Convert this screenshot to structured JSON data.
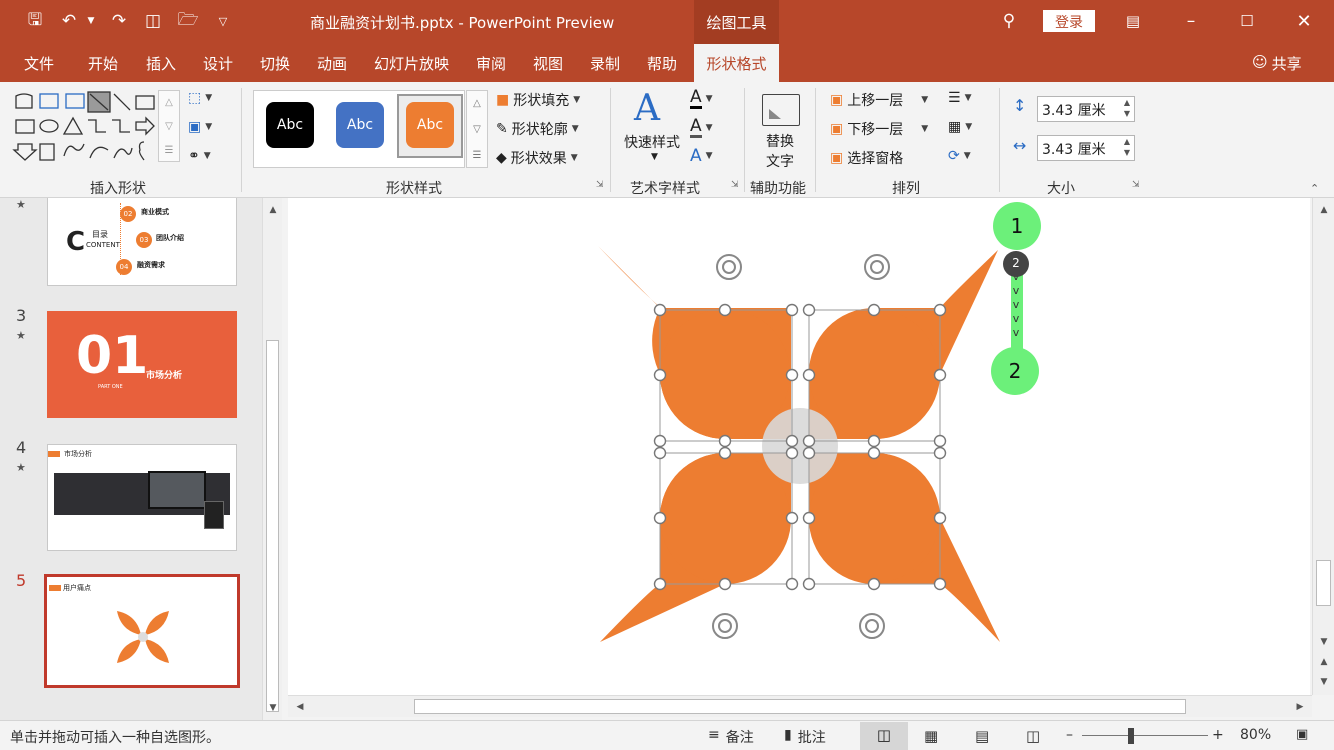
{
  "window": {
    "title": "商业融资计划书.pptx - PowerPoint Preview",
    "context_tab": "绘图工具",
    "login": "登录"
  },
  "tabs": [
    "文件",
    "开始",
    "插入",
    "设计",
    "切换",
    "动画",
    "幻灯片放映",
    "审阅",
    "视图",
    "录制",
    "帮助",
    "形状格式"
  ],
  "active_tab": "形状格式",
  "share": "共享",
  "ribbon": {
    "groups": {
      "insert_shapes": "插入形状",
      "shape_styles": "形状样式",
      "wordart": "艺术字样式",
      "accessibility": "辅助功能",
      "arrange": "排列",
      "size": "大小"
    },
    "style_samples": [
      "Abc",
      "Abc",
      "Abc"
    ],
    "fill": "形状填充",
    "outline": "形状轮廓",
    "effects": "形状效果",
    "quick_styles": "快速样式",
    "alt_text": [
      "替换",
      "文字"
    ],
    "bring_forward": "上移一层",
    "send_backward": "下移一层",
    "selection_pane": "选择窗格",
    "height": "3.43 厘米",
    "width": "3.43 厘米"
  },
  "thumbnails": [
    {
      "num": "3",
      "title": "01",
      "subtitle": "市场分析",
      "caption": "PART ONE"
    },
    {
      "num": "4",
      "title": "市场分析"
    },
    {
      "num": "5",
      "title": "用户痛点"
    }
  ],
  "thumb2": {
    "toc": "目录",
    "content": "CONTENT",
    "items": [
      {
        "n": "02",
        "t": "商业模式"
      },
      {
        "n": "03",
        "t": "团队介绍"
      },
      {
        "n": "04",
        "t": "融资需求"
      }
    ]
  },
  "annotations": {
    "start": "1",
    "mid": "2",
    "end": "2"
  },
  "status": {
    "hint": "单击并拖动可插入一种自选图形。",
    "notes": "备注",
    "comments": "批注",
    "zoom": "80%"
  },
  "colors": {
    "accent": "#b7472a",
    "shape": "#ed7d31",
    "marker": "#6cf07a"
  }
}
